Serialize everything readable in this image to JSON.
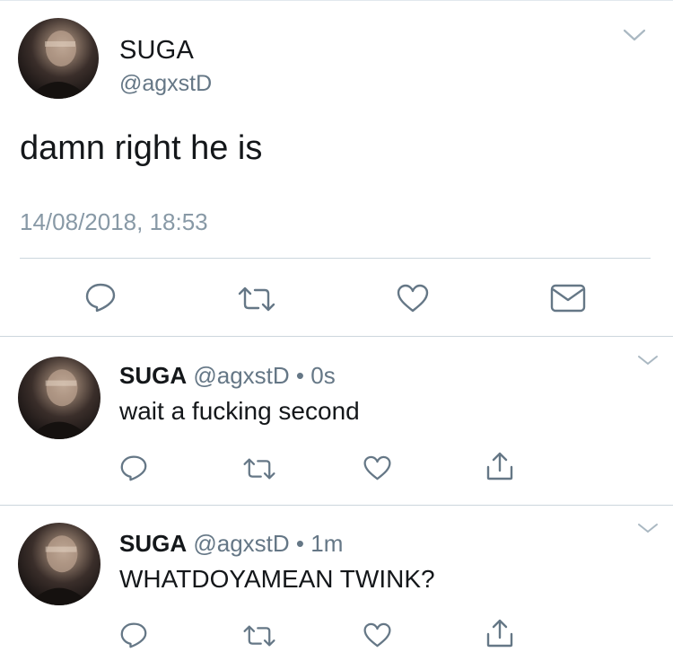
{
  "main_tweet": {
    "name": "SUGA",
    "handle": "@agxstD",
    "text": "damn right he is",
    "timestamp": "14/08/2018, 18:53",
    "actions": [
      "reply-icon",
      "retweet-icon",
      "like-icon",
      "message-icon"
    ]
  },
  "replies": [
    {
      "name": "SUGA",
      "handle": "@agxstD",
      "separator": "•",
      "time": "0s",
      "text": "wait a fucking second",
      "actions": [
        "reply-icon",
        "retweet-icon",
        "like-icon",
        "share-icon"
      ]
    },
    {
      "name": "SUGA",
      "handle": "@agxstD",
      "separator": "•",
      "time": "1m",
      "text": "WHATDOYAMEAN TWINK?",
      "actions": [
        "reply-icon",
        "retweet-icon",
        "like-icon",
        "share-icon"
      ]
    }
  ],
  "colors": {
    "text_primary": "#14171a",
    "text_secondary": "#657786",
    "timestamp": "#8899a6",
    "divider": "#ccd6dd"
  }
}
